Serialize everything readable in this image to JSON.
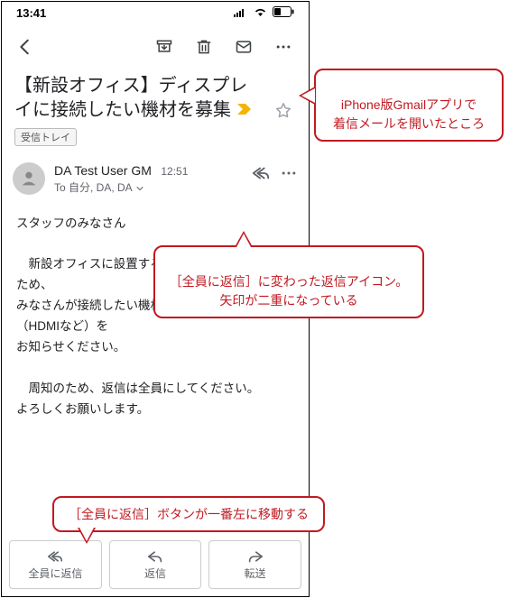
{
  "status": {
    "time": "13:41"
  },
  "subject": "【新設オフィス】ディスプレイに接続したい機材を募集",
  "label": "受信トレイ",
  "sender": {
    "name": "DA Test User GM",
    "time": "12:51",
    "to_line": "To 自分, DA, DA"
  },
  "body": "スタッフのみなさん\n\n　新設オフィスに設置するディスプレイを決めるため、\nみなさんが接続したい機材とそのポート規格（HDMIなど）を\nお知らせください。\n\n　周知のため、返信は全員にしてください。\nよろしくお願いします。",
  "bottom": {
    "reply_all": "全員に返信",
    "reply": "返信",
    "forward": "転送"
  },
  "callouts": {
    "c1": "iPhone版Gmailアプリで\n着信メールを開いたところ",
    "c2": "［全員に返信］に変わった返信アイコン。\n矢印が二重になっている",
    "c3": "［全員に返信］ボタンが一番左に移動する"
  }
}
